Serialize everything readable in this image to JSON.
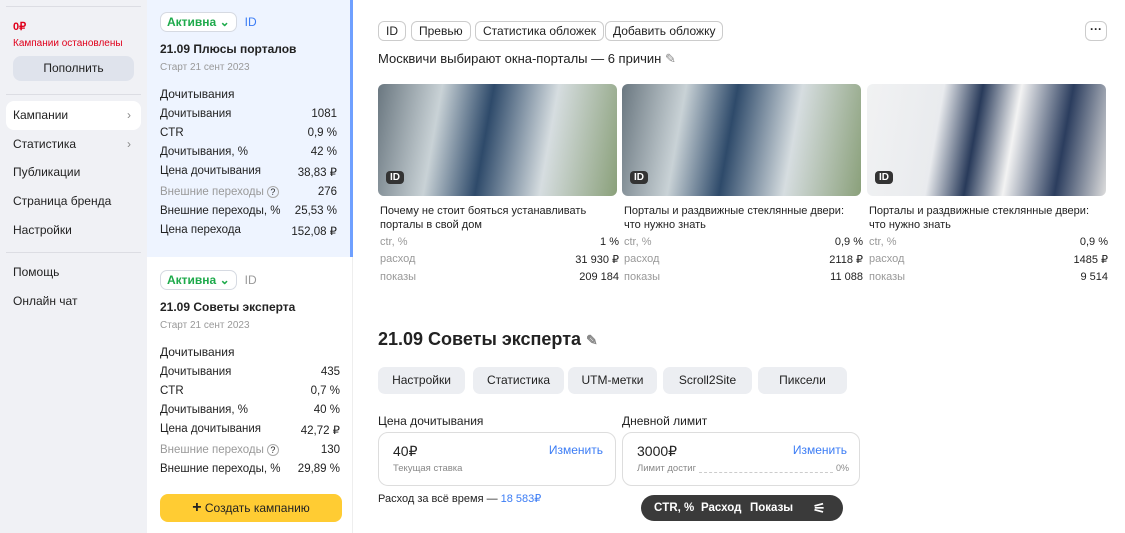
{
  "sidebar": {
    "balance": "0₽",
    "status": "Кампании остановлены",
    "topup": "Пополнить",
    "items": [
      {
        "label": "Кампании"
      },
      {
        "label": "Статистика"
      },
      {
        "label": "Публикации"
      },
      {
        "label": "Страница бренда"
      },
      {
        "label": "Настройки"
      }
    ],
    "help": "Помощь",
    "chat": "Онлайн чат"
  },
  "campaigns": [
    {
      "status": "Активна",
      "id": "ID",
      "title": "21.09 Плюсы порталов",
      "start": "Старт 21 сент 2023",
      "section": "Дочитывания",
      "rows": [
        [
          "Дочитывания",
          "1081"
        ],
        [
          "CTR",
          "0,9 %"
        ],
        [
          "Дочитывания, %",
          "42 %"
        ],
        [
          "Цена дочитывания",
          "38,83 ₽"
        ],
        [
          "Внешние переходы",
          "276"
        ],
        [
          "Внешние переходы, %",
          "25,53 %"
        ],
        [
          "Цена перехода",
          "152,08 ₽"
        ]
      ]
    },
    {
      "status": "Активна",
      "id": "ID",
      "title": "21.09 Советы эксперта",
      "start": "Старт 21 сент 2023",
      "section": "Дочитывания",
      "rows": [
        [
          "Дочитывания",
          "435"
        ],
        [
          "CTR",
          "0,7 %"
        ],
        [
          "Дочитывания, %",
          "40 %"
        ],
        [
          "Цена дочитывания",
          "42,72 ₽"
        ],
        [
          "Внешние переходы",
          "130"
        ],
        [
          "Внешние переходы, %",
          "29,89 %"
        ]
      ]
    }
  ],
  "create": "Создать кампанию",
  "main": {
    "pills": [
      "ID",
      "Превью",
      "Статистика обложек",
      "Добавить обложку"
    ],
    "more": "···",
    "title": "Москвичи выбирают окна-порталы — 6 причин",
    "covers": [
      {
        "badge": "ID",
        "caption": "Почему не стоит бояться устанавливать порталы в свой дом",
        "ctr": [
          "ctr, %",
          "1 %"
        ],
        "spend": [
          "расход",
          "31 930 ₽"
        ],
        "views": [
          "показы",
          "209 184"
        ]
      },
      {
        "badge": "ID",
        "caption": "Порталы и раздвижные стеклянные двери: что нужно знать",
        "ctr": [
          "ctr, %",
          "0,9 %"
        ],
        "spend": [
          "расход",
          "2118 ₽"
        ],
        "views": [
          "показы",
          "11 088"
        ]
      },
      {
        "badge": "ID",
        "caption": "Порталы и раздвижные стеклянные двери: что нужно знать",
        "ctr": [
          "ctr, %",
          "0,9 %"
        ],
        "spend": [
          "расход",
          "1485 ₽"
        ],
        "views": [
          "показы",
          "9 514"
        ]
      }
    ],
    "campaign_title": "21.09 Советы эксперта",
    "buttons": [
      "Настройки",
      "Статистика",
      "UTM-метки",
      "Scroll2Site",
      "Пиксели"
    ],
    "bid": {
      "label": "Цена дочитывания",
      "value": "40₽",
      "change": "Изменить",
      "sub": "Текущая ставка"
    },
    "limit": {
      "label": "Дневной лимит",
      "value": "3000₽",
      "change": "Изменить",
      "sub": "Лимит достиг",
      "pct": "0%",
      "progress": 0
    },
    "spend_label": "Расход за всё время — ",
    "spend_value": "18 583₽",
    "toolbar": [
      "CTR, %",
      "Расход",
      "Показы"
    ]
  }
}
